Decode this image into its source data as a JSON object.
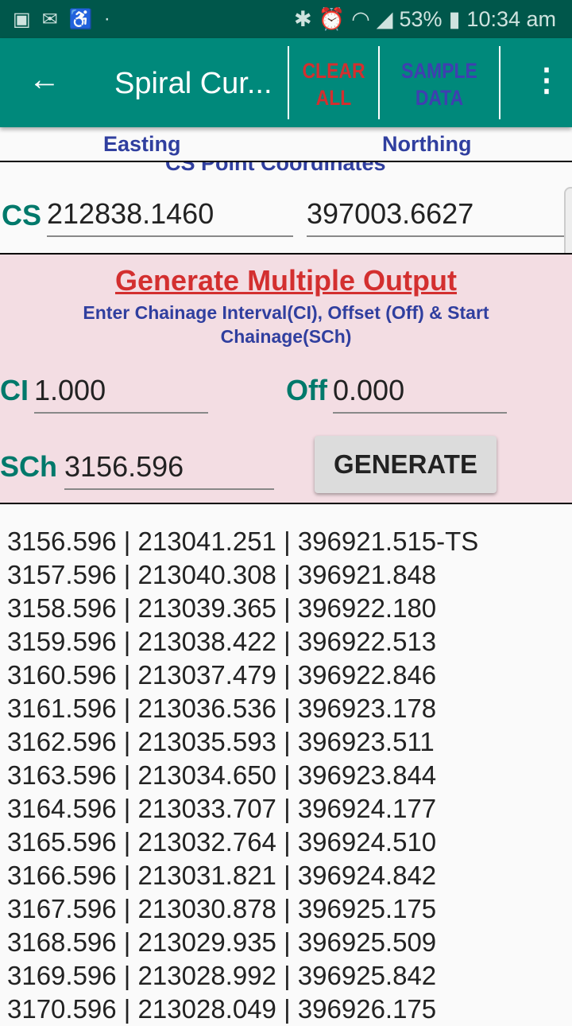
{
  "status_bar": {
    "battery": "53%",
    "time": "10:34 am"
  },
  "app_bar": {
    "title": "Spiral Cur...",
    "clear_all": "CLEAR\nALL",
    "sample_data": "SAMPLE\nDATA",
    "clear_color": "#d32f2f",
    "sample_color": "#3f3fb0"
  },
  "headers": {
    "easting": "Easting",
    "northing": "Northing"
  },
  "cs": {
    "section_title": "CS Point Coordinates",
    "label": "CS",
    "easting": "212838.1460",
    "northing": "397003.6627"
  },
  "generate": {
    "title": "Generate Multiple Output",
    "subtitle": "Enter Chainage Interval(CI), Offset (Off) & Start Chainage(SCh)",
    "ci_label": "CI",
    "ci_value": "1.000",
    "off_label": "Off",
    "off_value": "0.000",
    "sch_label": "SCh",
    "sch_value": "3156.596",
    "button": "GENERATE"
  },
  "output": [
    "3156.596 | 213041.251 | 396921.515-TS",
    "3157.596 | 213040.308 | 396921.848",
    "3158.596 | 213039.365 | 396922.180",
    "3159.596 | 213038.422 | 396922.513",
    "3160.596 | 213037.479 | 396922.846",
    "3161.596 | 213036.536 | 396923.178",
    "3162.596 | 213035.593 | 396923.511",
    "3163.596 | 213034.650 | 396923.844",
    "3164.596 | 213033.707 | 396924.177",
    "3165.596 | 213032.764 | 396924.510",
    "3166.596 | 213031.821 | 396924.842",
    "3167.596 | 213030.878 | 396925.175",
    "3168.596 | 213029.935 | 396925.509",
    "3169.596 | 213028.992 | 396925.842",
    "3170.596 | 213028.049 | 396926.175"
  ]
}
